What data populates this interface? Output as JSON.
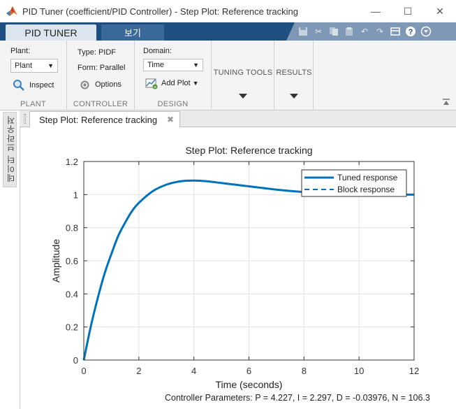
{
  "window": {
    "title": "PID Tuner (coefficient/PID Controller) - Step Plot: Reference tracking",
    "accent": "#0072bd"
  },
  "tabs": {
    "pid_tuner": "PID TUNER",
    "view": "보기"
  },
  "ribbon": {
    "plant": {
      "label": "Plant:",
      "button": "Plant",
      "inspect": "Inspect",
      "section": "PLANT"
    },
    "controller": {
      "type": "Type: PIDF",
      "form": "Form: Parallel",
      "options": "Options",
      "section": "CONTROLLER"
    },
    "design": {
      "domain_label": "Domain:",
      "domain_value": "Time",
      "add_plot": "Add Plot",
      "section": "DESIGN"
    },
    "tuning_tools": "TUNING TOOLS",
    "results": "RESULTS"
  },
  "side_panel": {
    "label": "데이터 브라우저"
  },
  "document": {
    "tab_label": "Step Plot: Reference tracking"
  },
  "params_text": "Controller Parameters: P = 4.227, I = 2.297, D = -0.03976, N = 106.3",
  "chart_data": {
    "type": "line",
    "title": "Step Plot: Reference tracking",
    "xlabel": "Time (seconds)",
    "ylabel": "Amplitude",
    "xlim": [
      0,
      12
    ],
    "ylim": [
      0,
      1.2
    ],
    "xticks": [
      0,
      2,
      4,
      6,
      8,
      10,
      12
    ],
    "yticks": [
      0,
      0.2,
      0.4,
      0.6,
      0.8,
      1,
      1.2
    ],
    "grid": true,
    "legend": "top-right",
    "series": [
      {
        "name": "Tuned response",
        "style": "solid",
        "color": "#0072bd",
        "x": [
          0,
          0.25,
          0.5,
          0.75,
          1,
          1.25,
          1.5,
          1.75,
          2,
          2.5,
          3,
          3.5,
          4,
          4.5,
          5,
          5.5,
          6,
          7,
          8,
          9,
          10,
          11,
          12
        ],
        "y": [
          0,
          0.2,
          0.37,
          0.52,
          0.64,
          0.75,
          0.83,
          0.9,
          0.95,
          1.02,
          1.06,
          1.08,
          1.085,
          1.08,
          1.07,
          1.06,
          1.05,
          1.03,
          1.015,
          1.005,
          1.0,
          1.0,
          1.0
        ]
      },
      {
        "name": "Block response",
        "style": "dashed",
        "color": "#0072bd",
        "x": [
          0,
          0.25,
          0.5,
          0.75,
          1,
          1.25,
          1.5,
          1.75,
          2,
          2.5,
          3,
          3.5,
          4,
          4.5,
          5,
          5.5,
          6,
          7,
          8,
          9,
          10,
          11,
          12
        ],
        "y": [
          0,
          0.2,
          0.37,
          0.52,
          0.64,
          0.75,
          0.83,
          0.9,
          0.95,
          1.02,
          1.06,
          1.08,
          1.085,
          1.08,
          1.07,
          1.06,
          1.05,
          1.03,
          1.015,
          1.005,
          1.0,
          1.0,
          1.0
        ]
      }
    ]
  }
}
